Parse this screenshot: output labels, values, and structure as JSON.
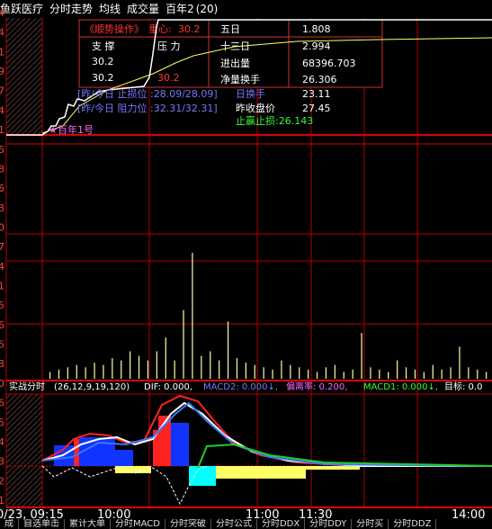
{
  "header": {
    "items": [
      "鱼跃医疗",
      "分时走势",
      "均线",
      "成交量",
      "百年2"
    ],
    "badge": "(20)"
  },
  "info_panel": {
    "title": "《顺势操作》",
    "center_label": "重心:",
    "center_value": "30.2",
    "col_support": "支 撑",
    "col_pressure": "压 力",
    "rows": [
      {
        "support": "30.2",
        "pressure": "",
        "label": "五日",
        "value": "1.808"
      },
      {
        "support": "30.2",
        "pressure": "",
        "label": "十三日",
        "value": "2.994"
      },
      {
        "support": "30.2",
        "pressure": "30.2",
        "label": "进出量",
        "value": "68396.703"
      },
      {
        "support": "",
        "pressure": "",
        "label": "净量换手",
        "value": "26.306"
      }
    ]
  },
  "annotations": {
    "stop_loss": "[昨/今日 止损位 :28.09/28.09]",
    "turnover_label": "日换手",
    "turnover_value": "23.11",
    "resistance": "[昨/今日 阻力位 :32.31/32.31]",
    "prev_close_label": "昨收盘价",
    "prev_close_value": "27.45",
    "take_profit": "止赢止损:26.143",
    "marker": "百年1号"
  },
  "y_axis_labels": [
    "4",
    "4",
    "1",
    "9",
    "7",
    "4",
    "1",
    "5",
    "8",
    "6",
    "3",
    "0",
    "7",
    "4",
    "1",
    "5",
    "6",
    "5",
    "3",
    "0",
    "6",
    "5",
    "4",
    "3",
    "2",
    "1"
  ],
  "indicator_bar": {
    "name": "实战分时",
    "params": "(26,12,9,19,120)",
    "dif": "DIF: 0.000,",
    "macd2": "MACD2: 0.000↓,",
    "bias": "偏离率: 0.200,",
    "macd1": "MACD1: 0.000↓,",
    "target": "目标: 0.0"
  },
  "time_axis": [
    "0/23, 09:15",
    "10:00",
    "11:00",
    "11:30",
    "14:00"
  ],
  "bottom_tabs": [
    "成",
    "自选单击",
    "累计大单",
    "分时MACD",
    "分时突破",
    "分时公式",
    "分时DDX",
    "分时DDY",
    "分时买",
    "分时DDZ"
  ],
  "colors": {
    "grid": "#b00000",
    "price_line": "#ffffff",
    "avg_line": "#ffff66",
    "volume": "#ffffaa",
    "panel_border": "#cc3333",
    "accent_red": "#ff3333",
    "accent_green": "#33ff33"
  },
  "chart_data": {
    "type": "line",
    "title": "",
    "price": [
      26.0,
      26.0,
      26.1,
      26.3,
      26.8,
      27.4,
      28.0,
      28.4,
      29.0,
      30.2,
      30.2,
      30.2,
      30.2,
      30.2,
      30.2,
      30.2,
      30.2,
      30.2,
      30.2,
      30.2
    ],
    "volume": [
      3,
      4,
      5,
      6,
      5,
      7,
      6,
      9,
      8,
      12,
      10,
      8,
      12,
      18,
      8,
      30,
      55,
      10,
      12,
      8,
      25,
      9,
      7,
      6,
      5,
      4,
      8,
      6,
      5,
      4,
      3,
      5,
      6,
      3,
      4,
      20,
      5,
      4,
      3,
      8,
      5,
      4,
      3,
      6,
      4,
      5,
      14,
      5,
      4,
      3
    ]
  }
}
